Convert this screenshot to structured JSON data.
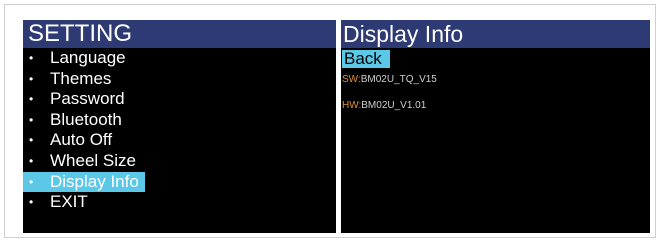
{
  "settings": {
    "title": "SETTING",
    "items": [
      {
        "label": "Language",
        "selected": false
      },
      {
        "label": "Themes",
        "selected": false
      },
      {
        "label": "Password",
        "selected": false
      },
      {
        "label": "Bluetooth",
        "selected": false
      },
      {
        "label": "Auto Off",
        "selected": false
      },
      {
        "label": "Wheel Size",
        "selected": false
      },
      {
        "label": "Display Info",
        "selected": true
      },
      {
        "label": "EXIT",
        "selected": false
      }
    ]
  },
  "display_info": {
    "title": "Display Info",
    "back_label": "Back",
    "sw_key": "SW:",
    "sw_value": "BM02U_TQ_V15",
    "hw_key": "HW:",
    "hw_value": "BM02U_V1.01"
  },
  "colors": {
    "title_bar": "#2e3a73",
    "panel_bg": "#000000",
    "highlight": "#5bc8e8",
    "info_key": "#e0902a",
    "info_value": "#cfcfcf"
  },
  "icons": {
    "bullet": "bullet-dot"
  }
}
